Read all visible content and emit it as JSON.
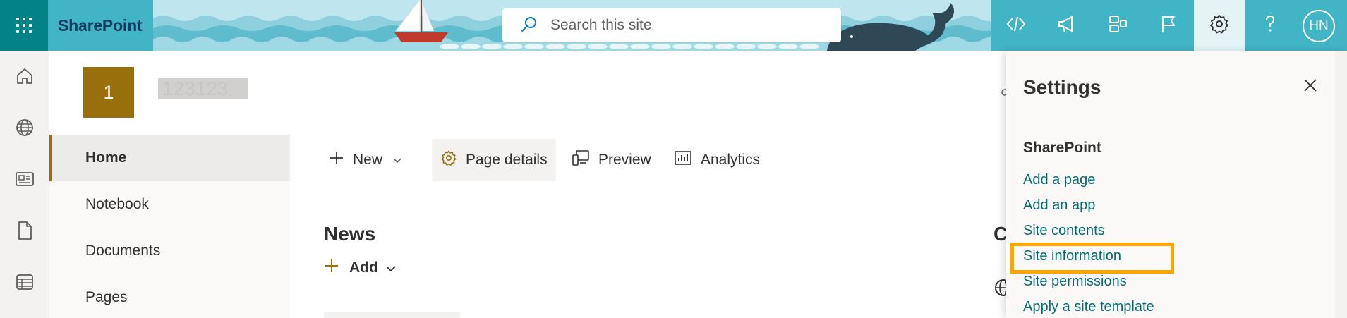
{
  "suite": {
    "app_name": "SharePoint",
    "search_placeholder": "Search this site",
    "user_initials": "HN",
    "icons": [
      "waffle-icon",
      "code-icon",
      "megaphone-icon",
      "feedback-icon",
      "flag-icon",
      "gear-icon",
      "help-icon"
    ]
  },
  "appbar": {
    "icons": [
      "home-icon",
      "globe-icon",
      "news-icon",
      "file-icon",
      "list-icon"
    ]
  },
  "site": {
    "logo_letter": "1",
    "title": "123123"
  },
  "leftnav": {
    "items": [
      {
        "label": "Home",
        "selected": true
      },
      {
        "label": "Notebook",
        "selected": false
      },
      {
        "label": "Documents",
        "selected": false
      },
      {
        "label": "Pages",
        "selected": false
      }
    ]
  },
  "commandbar": {
    "new_label": "New",
    "page_details_label": "Page details",
    "preview_label": "Preview",
    "analytics_label": "Analytics"
  },
  "news": {
    "title": "News",
    "add_label": "Add"
  },
  "main": {
    "partial_heading": "C"
  },
  "settings": {
    "title": "Settings",
    "section": "SharePoint",
    "links": [
      "Add a page",
      "Add an app",
      "Site contents",
      "Site information",
      "Site permissions",
      "Apply a site template"
    ],
    "focused_link": "Site information"
  },
  "colors": {
    "theme_primary": "#986f0b",
    "suite_bar": "#41b4c6",
    "waffle_bg": "#038387",
    "link": "#036c70",
    "focus_outline": "#ffa500"
  }
}
